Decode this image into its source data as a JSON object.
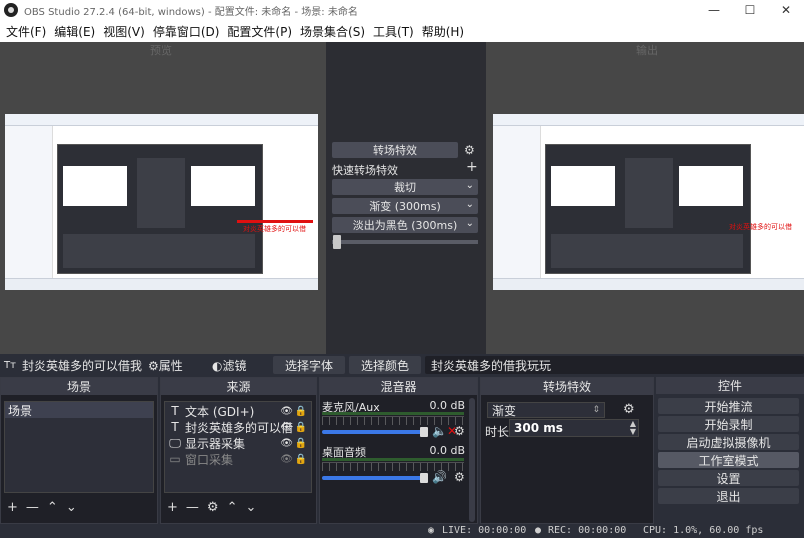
{
  "window": {
    "title": "OBS Studio 27.2.4 (64-bit, windows) - 配置文件: 未命名 - 场景: 未命名",
    "minimize": "—",
    "maximize": "☐",
    "close": "✕"
  },
  "menu": [
    "文件(F)",
    "编辑(E)",
    "视图(V)",
    "停靠窗口(D)",
    "配置文件(P)",
    "场景集合(S)",
    "工具(T)",
    "帮助(H)"
  ],
  "preview": {
    "preview_label": "预览",
    "program_label": "输出"
  },
  "transition_panel": {
    "button": "转场特效",
    "quick_label": "快速转场特效",
    "options": [
      "裁切",
      "渐变 (300ms)",
      "淡出为黑色 (300ms)"
    ]
  },
  "source_toolbar": {
    "source_name": "封炎英雄多的可以借我",
    "properties": "属性",
    "filters": "滤镜",
    "select_font": "选择字体",
    "select_color": "选择颜色",
    "text_value": "封炎英雄多的借我玩玩"
  },
  "scenes": {
    "header": "场景",
    "items": [
      "场景"
    ]
  },
  "sources": {
    "header": "来源",
    "items": [
      {
        "label": "文本 (GDI+)",
        "icon": "text-icon",
        "glyph": "T"
      },
      {
        "label": "封炎英雄多的可以借",
        "icon": "text-icon",
        "glyph": "T"
      },
      {
        "label": "显示器采集",
        "icon": "monitor-icon",
        "glyph": "🖵"
      },
      {
        "label": "窗口采集",
        "icon": "window-icon",
        "glyph": "▭"
      }
    ]
  },
  "mixer": {
    "header": "混音器",
    "channels": [
      {
        "name": "麦克风/Aux",
        "db": "0.0 dB",
        "muted": true,
        "volume": 0.75
      },
      {
        "name": "桌面音频",
        "db": "0.0 dB",
        "muted": false,
        "volume": 0.75
      }
    ]
  },
  "transitions": {
    "header": "转场特效",
    "selected": "渐变",
    "duration_label": "时长",
    "duration_value": "300 ms"
  },
  "controls": {
    "header": "控件",
    "buttons": [
      "开始推流",
      "开始录制",
      "启动虚拟摄像机",
      "工作室模式",
      "设置",
      "退出"
    ]
  },
  "status": {
    "live": "LIVE: 00:00:00",
    "rec": "REC: 00:00:00",
    "cpu": "CPU: 1.0%, 60.00 fps"
  },
  "colors": {
    "background": "#2b2e38",
    "accent": "#3b78e7",
    "muted": "#e01010"
  }
}
